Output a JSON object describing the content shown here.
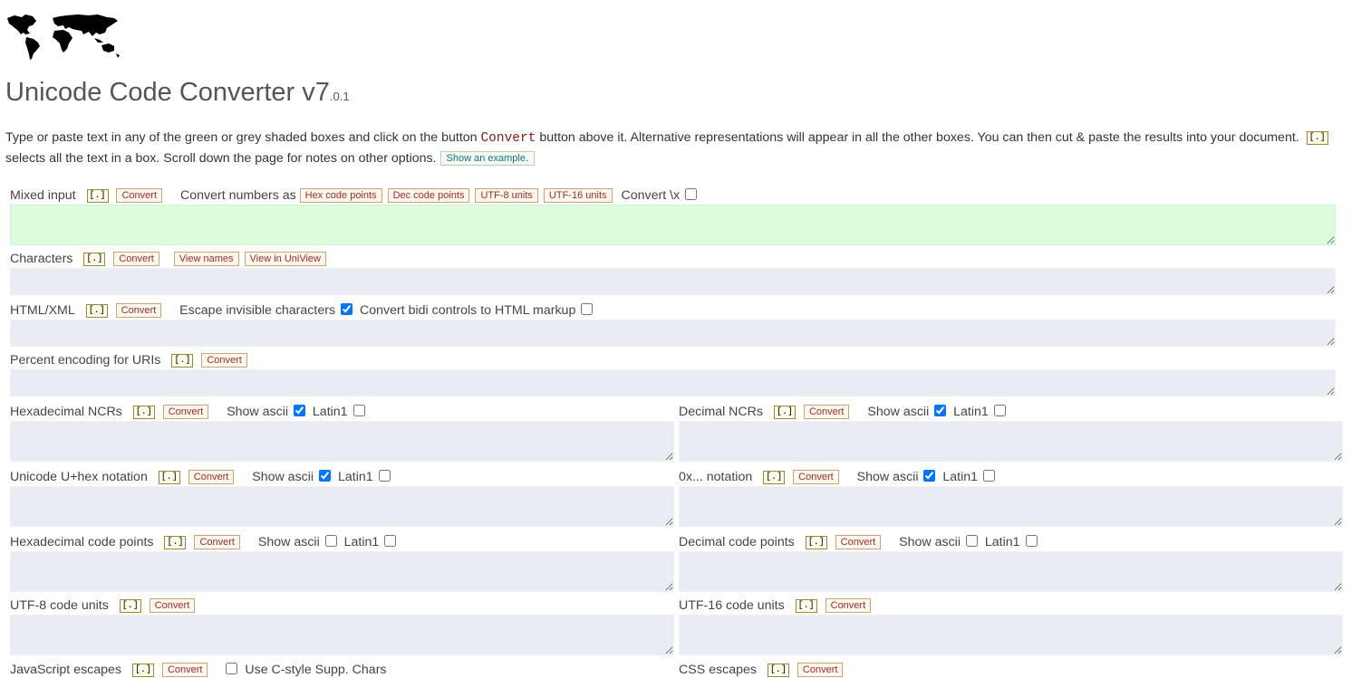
{
  "title": {
    "main": "Unicode Code Converter v7",
    "minor": ".0.1"
  },
  "intro": {
    "part1": "Type or paste text in any of the green or grey shaded boxes and click on the button ",
    "code": "Convert",
    "part2": " button above it. Alternative representations will appear in all the other boxes. You can then cut & paste the results into your document. ",
    "part3": " selects all the text in a box. Scroll down the page for notes on other options. ",
    "example_button": "Show an example."
  },
  "select_icon": "[.]",
  "convert_label": "Convert",
  "mixed": {
    "label": "Mixed input",
    "numbers_label": "Convert numbers as",
    "hex_btn": "Hex code points",
    "dec_btn": "Dec code points",
    "utf8_btn": "UTF-8 units",
    "utf16_btn": "UTF-16 units",
    "convert_x": "Convert \\x",
    "convert_x_checked": false
  },
  "characters": {
    "label": "Characters",
    "view_names": "View names",
    "view_uniview": "View in UniView"
  },
  "html": {
    "label": "HTML/XML",
    "escape_label": "Escape invisible characters",
    "escape_checked": true,
    "bidi_label": "Convert bidi controls to HTML markup",
    "bidi_checked": false
  },
  "percent": {
    "label": "Percent encoding for URIs"
  },
  "show_ascii": "Show ascii",
  "latin1": "Latin1",
  "hex_ncr": {
    "label": "Hexadecimal NCRs",
    "ascii": true,
    "latin1": false
  },
  "dec_ncr": {
    "label": "Decimal NCRs",
    "ascii": true,
    "latin1": false
  },
  "uplus": {
    "label": "Unicode U+hex notation",
    "ascii": true,
    "latin1": false
  },
  "zerox": {
    "label": "0x... notation",
    "ascii": true,
    "latin1": false
  },
  "hex_cp": {
    "label": "Hexadecimal code points",
    "ascii": false,
    "latin1": false
  },
  "dec_cp": {
    "label": "Decimal code points",
    "ascii": false,
    "latin1": false
  },
  "utf8": {
    "label": "UTF-8 code units"
  },
  "utf16": {
    "label": "UTF-16 code units"
  },
  "js": {
    "label": "JavaScript escapes",
    "cstyle": "Use C-style Supp. Chars",
    "cstyle_checked": false
  },
  "css": {
    "label": "CSS escapes"
  }
}
